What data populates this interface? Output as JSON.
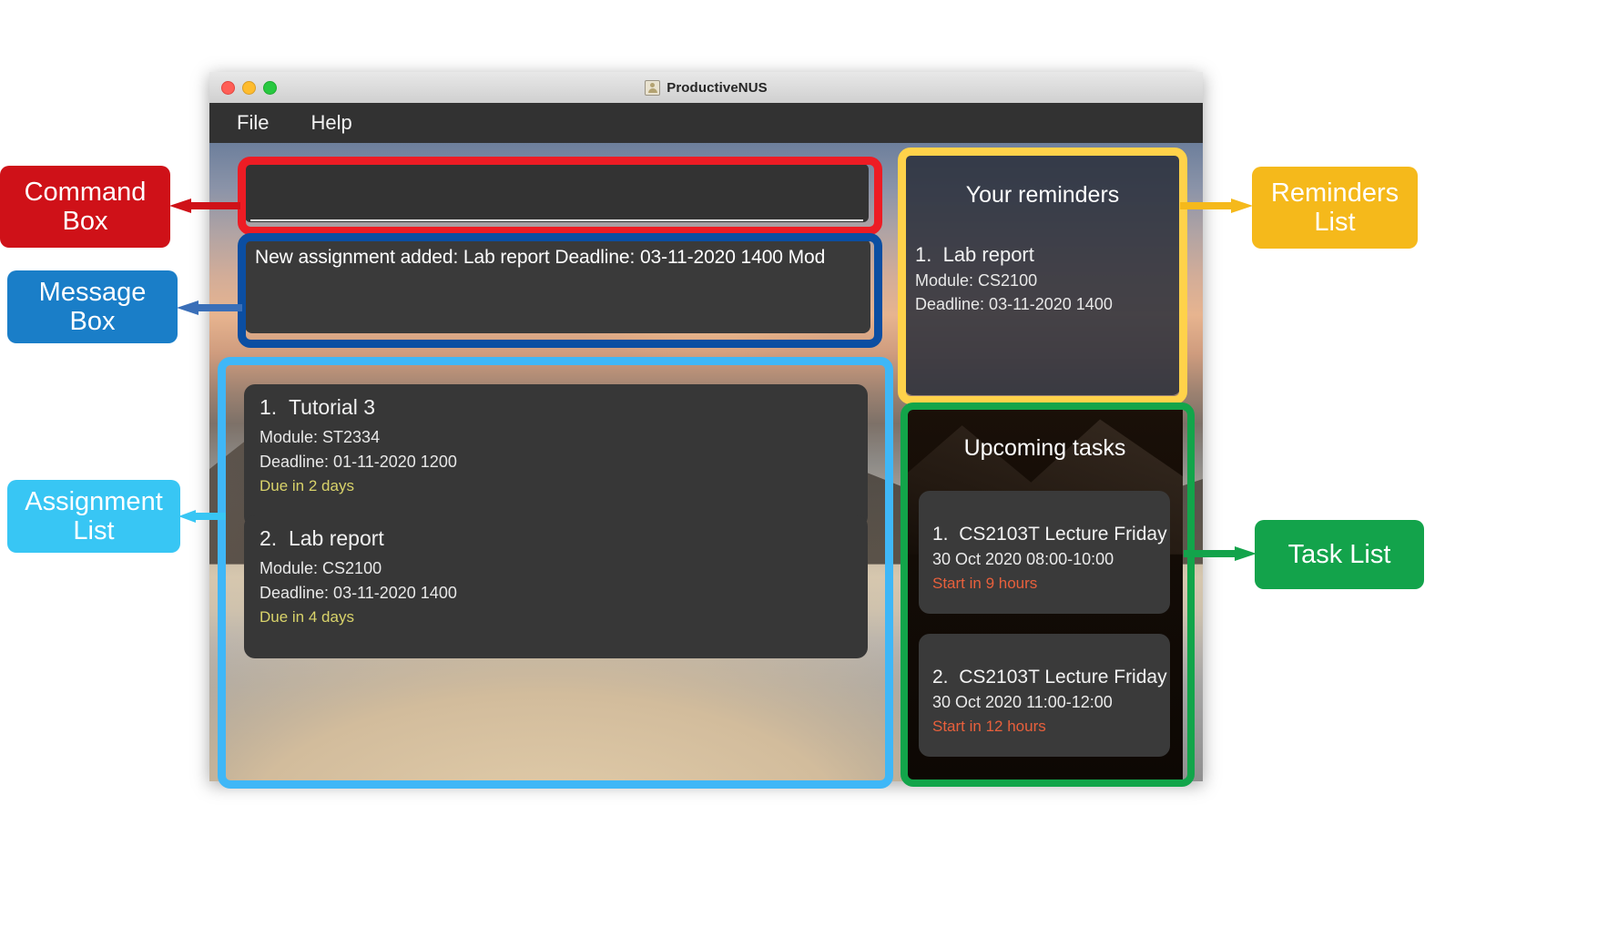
{
  "window": {
    "title": "ProductiveNUS",
    "title_icon": "address-book-icon",
    "traffic_lights": [
      "close",
      "minimize",
      "zoom"
    ],
    "menubar": [
      "File",
      "Help"
    ]
  },
  "command_box": {
    "value": "",
    "placeholder": ""
  },
  "message_box": {
    "text": "New assignment added: Lab report Deadline: 03-11-2020 1400 Mod"
  },
  "assignment_list": {
    "items": [
      {
        "index": "1.",
        "name": "Tutorial 3",
        "module": "Module: ST2334",
        "deadline": "Deadline: 01-11-2020 1200",
        "due": "Due in 2 days"
      },
      {
        "index": "2.",
        "name": "Lab report",
        "module": "Module: CS2100",
        "deadline": "Deadline: 03-11-2020 1400",
        "due": "Due in 4 days"
      }
    ]
  },
  "reminders": {
    "heading": "Your reminders",
    "items": [
      {
        "index": "1.",
        "name": "Lab report",
        "module": "Module: CS2100",
        "deadline": "Deadline: 03-11-2020 1400"
      }
    ]
  },
  "tasks": {
    "heading": "Upcoming tasks",
    "items": [
      {
        "index": "1.",
        "name": "CS2103T Lecture Friday",
        "datetime": "30 Oct 2020 08:00-10:00",
        "start": "Start in 9 hours"
      },
      {
        "index": "2.",
        "name": "CS2103T Lecture Friday",
        "datetime": "30 Oct 2020 11:00-12:00",
        "start": "Start in 12 hours"
      }
    ]
  },
  "annotations": [
    {
      "key": "command",
      "label": "Command Box",
      "color": "#cf1118"
    },
    {
      "key": "message",
      "label": "Message Box",
      "color": "#1a7ec8"
    },
    {
      "key": "assignment",
      "label": "Assignment List",
      "color": "#38c6f4"
    },
    {
      "key": "reminders",
      "label": "Reminders List",
      "color": "#f5b91b"
    },
    {
      "key": "task",
      "label": "Task List",
      "color": "#13a34b"
    }
  ],
  "colors": {
    "due_text": "#d9d36a",
    "start_text": "#e8603c",
    "panel_bg": "#3a3a3a",
    "menubar_bg": "#323232"
  }
}
